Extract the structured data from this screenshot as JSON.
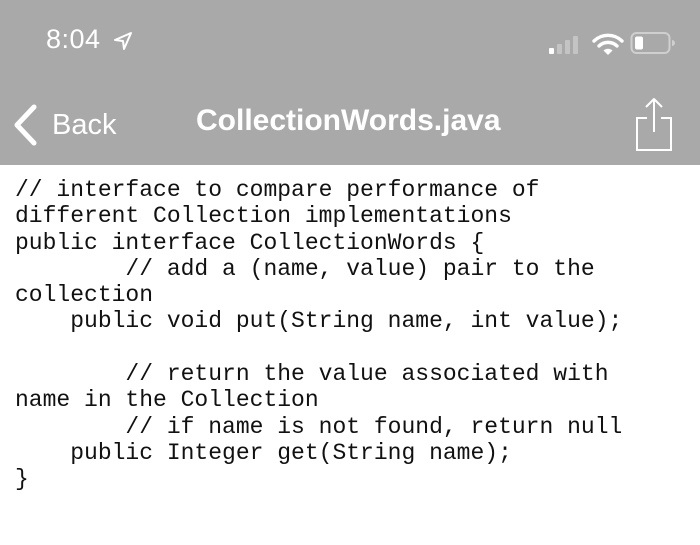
{
  "status_bar": {
    "time": "8:04",
    "location_icon": "location-arrow-icon",
    "signal_icon": "cellular-signal-icon",
    "wifi_icon": "wifi-icon",
    "battery_icon": "battery-low-icon"
  },
  "nav_bar": {
    "back_label": "Back",
    "title": "CollectionWords.java",
    "share_icon": "share-icon"
  },
  "file": {
    "lines": [
      "// interface to compare performance of",
      "different Collection implementations",
      "public interface CollectionWords {",
      "        // add a (name, value) pair to the",
      "collection",
      "    public void put(String name, int value);",
      "",
      "        // return the value associated with",
      "name in the Collection",
      "        // if name is not found, return null",
      "    public Integer get(String name);",
      "}"
    ]
  },
  "colors": {
    "header_bg": "#a9a9a9",
    "header_fg": "#ffffff",
    "content_bg": "#ffffff",
    "code_fg": "#111111"
  }
}
